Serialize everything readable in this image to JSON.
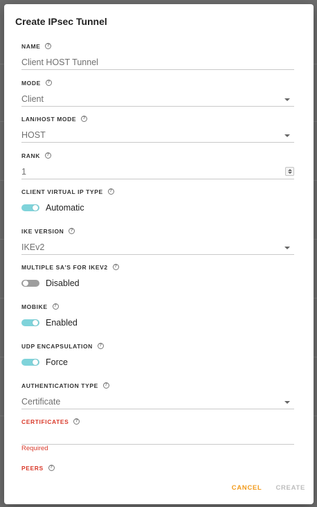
{
  "dialog": {
    "title": "Create IPsec Tunnel"
  },
  "fields": {
    "name": {
      "label": "NAME",
      "value": "Client HOST Tunnel"
    },
    "mode": {
      "label": "MODE",
      "value": "Client"
    },
    "lan_host_mode": {
      "label": "LAN/HOST MODE",
      "value": "HOST"
    },
    "rank": {
      "label": "RANK",
      "value": "1"
    },
    "client_virtual_ip_type": {
      "label": "CLIENT VIRTUAL IP TYPE",
      "state": "Automatic",
      "on": true
    },
    "ike_version": {
      "label": "IKE VERSION",
      "value": "IKEv2"
    },
    "multiple_sas": {
      "label": "MULTIPLE SA'S FOR IKEV2",
      "state": "Disabled",
      "on": false
    },
    "mobike": {
      "label": "MOBIKE",
      "state": "Enabled",
      "on": true
    },
    "udp_encapsulation": {
      "label": "UDP ENCAPSULATION",
      "state": "Force",
      "on": true
    },
    "authentication_type": {
      "label": "AUTHENTICATION TYPE",
      "value": "Certificate"
    },
    "certificates": {
      "label": "CERTIFICATES",
      "value": "",
      "error": "Required"
    },
    "peers": {
      "label": "PEERS"
    }
  },
  "help_glyph": "?",
  "actions": {
    "cancel": "CANCEL",
    "create": "CREATE"
  },
  "colors": {
    "accent_toggle": "#7fd3da",
    "cancel": "#f29b1d",
    "error": "#d93a2b",
    "disabled": "#bdbdbd"
  }
}
